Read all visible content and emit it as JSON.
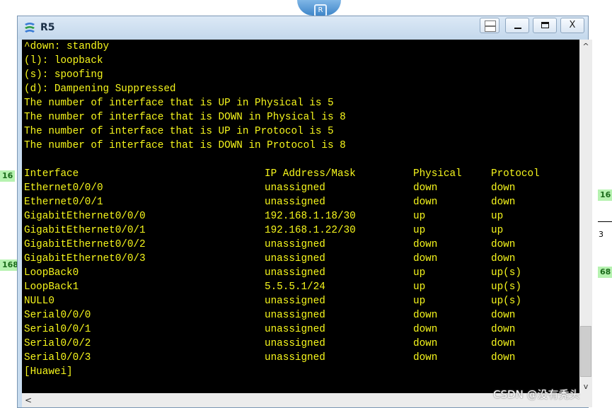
{
  "background": {
    "edge_labels": [
      "16",
      "16",
      "168",
      "68"
    ],
    "edge_mark": "3"
  },
  "window": {
    "title": "R5",
    "buttons": {
      "minimize": "_",
      "close": "X"
    }
  },
  "console": {
    "legend_lines": [
      "^down: standby",
      "(l): loopback",
      "(s): spoofing",
      "(d): Dampening Suppressed",
      "The number of interface that is UP in Physical is 5",
      "The number of interface that is DOWN in Physical is 8",
      "The number of interface that is UP in Protocol is 5",
      "The number of interface that is DOWN in Protocol is 8"
    ],
    "table_header": [
      "Interface",
      "IP Address/Mask",
      "Physical",
      "Protocol"
    ],
    "table_rows": [
      [
        "Ethernet0/0/0",
        "unassigned",
        "down",
        "down"
      ],
      [
        "Ethernet0/0/1",
        "unassigned",
        "down",
        "down"
      ],
      [
        "GigabitEthernet0/0/0",
        "192.168.1.18/30",
        "up",
        "up"
      ],
      [
        "GigabitEthernet0/0/1",
        "192.168.1.22/30",
        "up",
        "up"
      ],
      [
        "GigabitEthernet0/0/2",
        "unassigned",
        "down",
        "down"
      ],
      [
        "GigabitEthernet0/0/3",
        "unassigned",
        "down",
        "down"
      ],
      [
        "LoopBack0",
        "unassigned",
        "up",
        "up(s)"
      ],
      [
        "LoopBack1",
        "5.5.5.1/24",
        "up",
        "up(s)"
      ],
      [
        "NULL0",
        "unassigned",
        "up",
        "up(s)"
      ],
      [
        "Serial0/0/0",
        "unassigned",
        "down",
        "down"
      ],
      [
        "Serial0/0/1",
        "unassigned",
        "down",
        "down"
      ],
      [
        "Serial0/0/2",
        "unassigned",
        "down",
        "down"
      ],
      [
        "Serial0/0/3",
        "unassigned",
        "down",
        "down"
      ]
    ],
    "prompt": "[Huawei]",
    "text_color": "#f7f71c",
    "background_color": "#000000"
  },
  "scrollbars": {
    "up_arrow": "^",
    "down_arrow": "v",
    "left_arrow": "<"
  },
  "watermark": "CSDN @没有秃头"
}
